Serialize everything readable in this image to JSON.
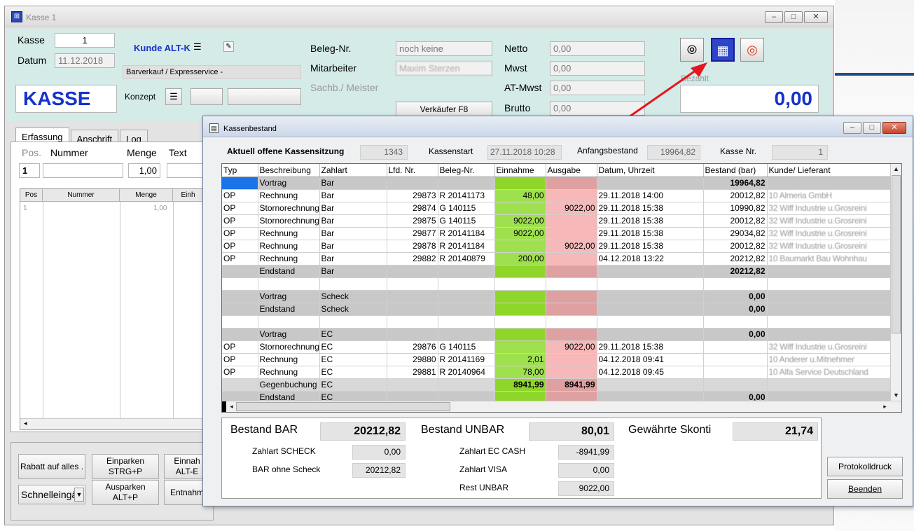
{
  "main_window": {
    "title": "Kasse 1",
    "win_buttons": [
      "–",
      "□",
      "✕"
    ],
    "kasse_label": "Kasse",
    "kasse_value": "1",
    "datum_label": "Datum",
    "datum_value": "11.12.2018",
    "kasse_big": "KASSE",
    "kunde_label": "Kunde ALT-K",
    "kunde_line": "Barverkauf  /  Expresservice -",
    "konzept_label": "Konzept",
    "beleg_label": "Beleg-Nr.",
    "beleg_value": "noch keine",
    "mitarbeiter_label": "Mitarbeiter",
    "mitarbeiter_value": "Maxim Sterzen",
    "sachb_label": "Sachb./ Meister",
    "verkaeufer_button": "Verkäufer F8",
    "netto_label": "Netto",
    "netto_value": "0,00",
    "mwst_label": "Mwst",
    "mwst_value": "0,00",
    "at_mwst_label": "AT-Mwst",
    "at_mwst_value": "0,00",
    "brutto_label": "Brutto",
    "brutto_value": "0,00",
    "bezahlt_label": "Bezahlt",
    "total_value": "0,00",
    "tabs": [
      "Erfassung",
      "Anschrift",
      "Log"
    ],
    "entry_headers": [
      "Pos.",
      "Nummer",
      "Menge",
      "Text"
    ],
    "entry_pos": "1",
    "entry_menge": "1,00",
    "grid_headers": [
      "Pos",
      "Nummer",
      "Menge",
      "Einh"
    ],
    "grid_row": [
      "1",
      "",
      "1,00",
      ""
    ],
    "buttons": {
      "rabatt": "Rabatt auf alles .",
      "einparken": "Einparken\nSTRG+P",
      "ausparken": "Ausparken\nALT+P",
      "einnahme": "Einnah\nALT-E",
      "entnahme": "Entnahm",
      "schnelleingabe": "Schnelleingä"
    }
  },
  "dialog": {
    "title": "Kassenbestand",
    "win_buttons": [
      "–",
      "□",
      "✕"
    ],
    "session_label": "Aktuell offene Kassensitzung",
    "session_value": "1343",
    "start_label": "Kassenstart",
    "start_value": "27.11.2018 10:28",
    "anfang_label": "Anfangsbestand",
    "anfang_value": "19964,82",
    "kasse_nr_label": "Kasse Nr.",
    "kasse_nr_value": "1",
    "columns": [
      "Typ",
      "Beschreibung",
      "Zahlart",
      "Lfd. Nr.",
      "Beleg-Nr.",
      "Einnahme",
      "Ausgabe",
      "Datum, Uhrzeit",
      "Bestand (bar)",
      "Kunde/ Lieferant"
    ],
    "rows": [
      {
        "kind": "sel",
        "cells": [
          "",
          "Vortrag",
          "Bar",
          "",
          "",
          "",
          "",
          "",
          "19964,82",
          ""
        ]
      },
      {
        "kind": "op",
        "cells": [
          "OP",
          "Rechnung",
          "Bar",
          "29873",
          "R 20141173",
          "48,00",
          "",
          "29.11.2018 14:00",
          "20012,82",
          "10 Almeria GmbH"
        ]
      },
      {
        "kind": "op",
        "cells": [
          "OP",
          "Stornorechnung",
          "Bar",
          "29874",
          "G 140115",
          "",
          "9022,00",
          "29.11.2018 15:38",
          "10990,82",
          "32 Wiff Industrie u.Grosreini"
        ]
      },
      {
        "kind": "op",
        "cells": [
          "OP",
          "Stornorechnung",
          "Bar",
          "29875",
          "G 140115",
          "9022,00",
          "",
          "29.11.2018 15:38",
          "20012,82",
          "32 Wiff Industrie u.Grosreini"
        ]
      },
      {
        "kind": "op",
        "cells": [
          "OP",
          "Rechnung",
          "Bar",
          "29877",
          "R 20141184",
          "9022,00",
          "",
          "29.11.2018 15:38",
          "29034,82",
          "32 Wiff Industrie u.Grosreini"
        ]
      },
      {
        "kind": "op",
        "cells": [
          "OP",
          "Rechnung",
          "Bar",
          "29878",
          "R 20141184",
          "",
          "9022,00",
          "29.11.2018 15:38",
          "20012,82",
          "32 Wiff Industrie u.Grosreini"
        ]
      },
      {
        "kind": "op",
        "cells": [
          "OP",
          "Rechnung",
          "Bar",
          "29882",
          "R 20140879",
          "200,00",
          "",
          "04.12.2018 13:22",
          "20212,82",
          "10 Baumarkt Bau Wohnhau"
        ]
      },
      {
        "kind": "sum",
        "cells": [
          "",
          "Endstand",
          "Bar",
          "",
          "",
          "",
          "",
          "",
          "20212,82",
          ""
        ]
      },
      {
        "kind": "empty",
        "cells": [
          "",
          "",
          "",
          "",
          "",
          "",
          "",
          "",
          "",
          ""
        ]
      },
      {
        "kind": "sum",
        "cells": [
          "",
          "Vortrag",
          "Scheck",
          "",
          "",
          "",
          "",
          "",
          "0,00",
          ""
        ]
      },
      {
        "kind": "sum",
        "cells": [
          "",
          "Endstand",
          "Scheck",
          "",
          "",
          "",
          "",
          "",
          "0,00",
          ""
        ]
      },
      {
        "kind": "empty",
        "cells": [
          "",
          "",
          "",
          "",
          "",
          "",
          "",
          "",
          "",
          ""
        ]
      },
      {
        "kind": "sum",
        "cells": [
          "",
          "Vortrag",
          "EC",
          "",
          "",
          "",
          "",
          "",
          "0,00",
          ""
        ]
      },
      {
        "kind": "op",
        "cells": [
          "OP",
          "Stornorechnung",
          "EC",
          "29876",
          "G 140115",
          "",
          "9022,00",
          "29.11.2018 15:38",
          "",
          "32 Wiff Industrie u.Grosreini"
        ]
      },
      {
        "kind": "op",
        "cells": [
          "OP",
          "Rechnung",
          "EC",
          "29880",
          "R 20141169",
          "2,01",
          "",
          "04.12.2018 09:41",
          "",
          "10 Anderer u.Mitnehmer"
        ]
      },
      {
        "kind": "op",
        "cells": [
          "OP",
          "Rechnung",
          "EC",
          "29881",
          "R 20140964",
          "78,00",
          "",
          "04.12.2018 09:45",
          "",
          "10 Alfa Service Deutschland"
        ]
      },
      {
        "kind": "gegen",
        "cells": [
          "",
          "Gegenbuchung",
          "EC",
          "",
          "",
          "8941,99",
          "8941,99",
          "",
          "",
          ""
        ]
      },
      {
        "kind": "sum",
        "cells": [
          "",
          "Endstand",
          "EC",
          "",
          "",
          "",
          "",
          "",
          "0,00",
          ""
        ]
      }
    ],
    "summary": {
      "bestand_bar_label": "Bestand BAR",
      "bestand_bar_value": "20212,82",
      "bestand_unbar_label": "Bestand UNBAR",
      "bestand_unbar_value": "80,01",
      "skonti_label": "Gewährte Skonti",
      "skonti_value": "21,74",
      "scheck_label": "Zahlart SCHECK",
      "scheck_value": "0,00",
      "bar_ohne_label": "BAR ohne Scheck",
      "bar_ohne_value": "20212,82",
      "ec_cash_label": "Zahlart EC CASH",
      "ec_cash_value": "-8941,99",
      "visa_label": "Zahlart VISA",
      "visa_value": "0,00",
      "rest_label": "Rest UNBAR",
      "rest_value": "9022,00"
    },
    "protokoll_button": "Protokolldruck",
    "beenden_button": "Beenden"
  },
  "icons": [
    "coins-icon",
    "cash-register-icon",
    "lifebuoy-icon",
    "pencil-icon",
    "list-icon",
    "arrow-icon"
  ],
  "colors": {
    "accent_blue": "#1432cc",
    "income_green": "#9fe04f",
    "expense_red": "#f6b8b8",
    "arrow_red": "#e8141e"
  }
}
